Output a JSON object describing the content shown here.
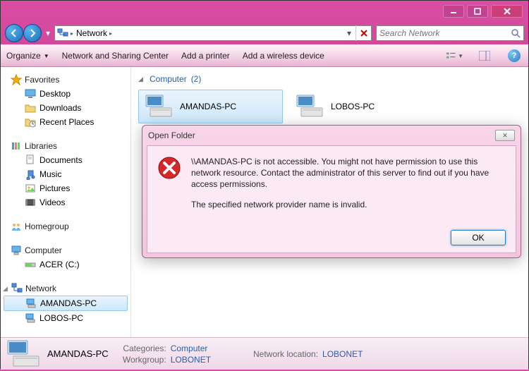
{
  "window": {
    "minimize": "_",
    "maximize": "□",
    "close": "×"
  },
  "nav": {
    "location_label": "Network",
    "stop": "×",
    "dropdown": "▾"
  },
  "search": {
    "placeholder": "Search Network"
  },
  "toolbar": {
    "organize": "Organize",
    "sharing_center": "Network and Sharing Center",
    "add_printer": "Add a printer",
    "add_wireless": "Add a wireless device"
  },
  "sidebar": {
    "favorites": {
      "label": "Favorites",
      "items": [
        "Desktop",
        "Downloads",
        "Recent Places"
      ]
    },
    "libraries": {
      "label": "Libraries",
      "items": [
        "Documents",
        "Music",
        "Pictures",
        "Videos"
      ]
    },
    "homegroup": {
      "label": "Homegroup"
    },
    "computer": {
      "label": "Computer",
      "items": [
        "ACER (C:)"
      ]
    },
    "network": {
      "label": "Network",
      "items": [
        "AMANDAS-PC",
        "LOBOS-PC"
      ]
    }
  },
  "content": {
    "group_label": "Computer",
    "group_count": "(2)",
    "computers": [
      {
        "name": "AMANDAS-PC",
        "selected": true
      },
      {
        "name": "LOBOS-PC",
        "selected": false
      }
    ]
  },
  "dialog": {
    "title": "Open Folder",
    "message1": "\\\\AMANDAS-PC is not accessible. You might not have permission to use this network resource. Contact the administrator of this server to find out if you have access permissions.",
    "message2": "The specified network provider name is invalid.",
    "ok": "OK"
  },
  "details": {
    "name": "AMANDAS-PC",
    "categories_label": "Categories:",
    "categories_value": "Computer",
    "workgroup_label": "Workgroup:",
    "workgroup_value": "LOBONET",
    "netloc_label": "Network location:",
    "netloc_value": "LOBONET"
  }
}
